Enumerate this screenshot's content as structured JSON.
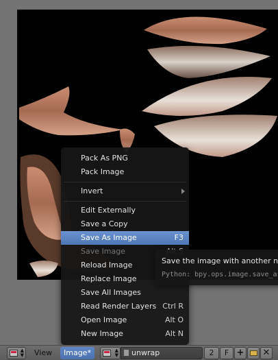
{
  "menu": {
    "items": [
      {
        "label": "Pack As PNG",
        "shortcut": "",
        "state": "normal"
      },
      {
        "label": "Pack Image",
        "shortcut": "",
        "state": "normal"
      },
      {
        "label": "Invert",
        "shortcut": "",
        "state": "submenu"
      },
      {
        "label": "Edit Externally",
        "shortcut": "",
        "state": "normal"
      },
      {
        "label": "Save a Copy",
        "shortcut": "",
        "state": "normal"
      },
      {
        "label": "Save As Image",
        "shortcut": "F3",
        "state": "highlight"
      },
      {
        "label": "Save Image",
        "shortcut": "Alt S",
        "state": "disabled"
      },
      {
        "label": "Reload Image",
        "shortcut": "",
        "state": "normal"
      },
      {
        "label": "Replace Image",
        "shortcut": "",
        "state": "normal"
      },
      {
        "label": "Save All Images",
        "shortcut": "",
        "state": "normal"
      },
      {
        "label": "Read Render Layers",
        "shortcut": "Ctrl R",
        "state": "normal"
      },
      {
        "label": "Open Image",
        "shortcut": "Alt O",
        "state": "normal"
      },
      {
        "label": "New Image",
        "shortcut": "Alt N",
        "state": "normal"
      }
    ]
  },
  "tooltip": {
    "title": "Save the image with another name",
    "python": "Python: bpy.ops.image.save_as()"
  },
  "header": {
    "view_label": "View",
    "image_label": "Image*",
    "image_name": "unwrap",
    "users": "2",
    "fake_user": "F",
    "new_icon": "plus-icon",
    "open_icon": "folder-icon",
    "unlink_icon": "close-icon"
  },
  "colors": {
    "highlight": "#5680c2",
    "menu_bg": "#161616",
    "canvas_bg": "#000000"
  }
}
